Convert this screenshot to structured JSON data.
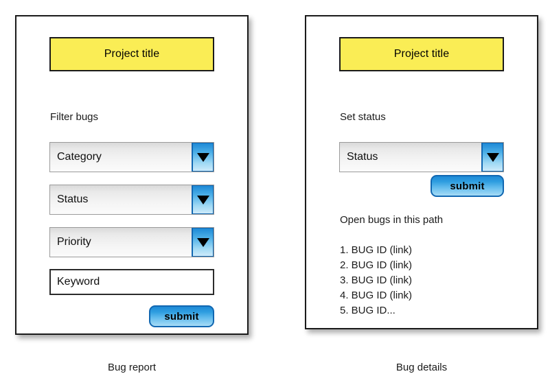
{
  "colors": {
    "title_bar_yellow": "#faed55",
    "accent_blue": "#1e8ad6",
    "accent_blue_border": "#1167b1",
    "panel_border": "#1a1a1a",
    "dropdown_gray": "#e9e9e9"
  },
  "panels": [
    {
      "id": "bug-report",
      "caption": "Bug report",
      "title": "Project title",
      "section_label": "Filter bugs",
      "dropdowns": [
        {
          "value": "Category",
          "icon": "chevron-down-icon"
        },
        {
          "value": "Status",
          "icon": "chevron-down-icon"
        },
        {
          "value": "Priority",
          "icon": "chevron-down-icon"
        }
      ],
      "keyword_input": {
        "value": "Keyword",
        "placeholder": "Keyword"
      },
      "submit_label": "submit"
    },
    {
      "id": "bug-details",
      "caption": "Bug details",
      "title": "Project title",
      "section_label": "Set status",
      "dropdowns": [
        {
          "value": "Status",
          "icon": "chevron-down-icon"
        }
      ],
      "submit_label": "submit",
      "list_heading": "Open bugs in this path",
      "bugs": [
        "1. BUG ID (link)",
        "2. BUG ID (link)",
        "3. BUG ID (link)",
        "4. BUG ID (link)",
        "5. BUG ID..."
      ]
    }
  ]
}
